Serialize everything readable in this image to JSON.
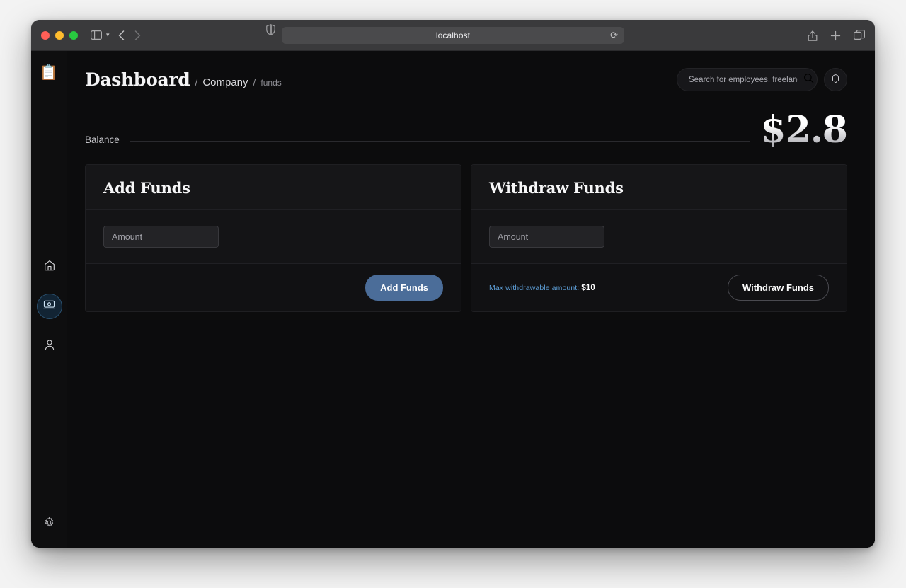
{
  "browser": {
    "url": "localhost",
    "icons": {
      "sidebar_toggle": "sidebar-toggle-icon",
      "tab_chevron": "chevron-down-icon",
      "back": "back-arrow-icon",
      "forward": "forward-arrow-icon",
      "shield": "privacy-shield-icon",
      "reload": "reload-icon",
      "share": "share-icon",
      "new_tab": "plus-icon",
      "tabs": "tab-overview-icon"
    }
  },
  "sidebar": {
    "logo": "📋",
    "items": [
      {
        "name": "home",
        "icon": "home-icon",
        "active": false
      },
      {
        "name": "funds",
        "icon": "money-card-icon",
        "active": true
      },
      {
        "name": "profile",
        "icon": "user-icon",
        "active": false
      }
    ],
    "settings": {
      "name": "settings",
      "icon": "gear-icon"
    }
  },
  "header": {
    "breadcrumb": {
      "title": "Dashboard",
      "separator1": "/",
      "company": "Company",
      "separator2": "/",
      "section": "funds"
    },
    "search": {
      "placeholder": "Search for employees, freelancers",
      "value": "",
      "icon": "search-icon"
    },
    "notifications_icon": "bell-icon"
  },
  "balance": {
    "label": "Balance",
    "value": "$2.8"
  },
  "cards": {
    "add_funds": {
      "title": "Add Funds",
      "input": {
        "placeholder": "Amount",
        "value": ""
      },
      "button": "Add Funds"
    },
    "withdraw_funds": {
      "title": "Withdraw Funds",
      "input": {
        "placeholder": "Amount",
        "value": ""
      },
      "note_label": "Max withdrawable amount:",
      "note_value": "$10",
      "button": "Withdraw Funds"
    }
  },
  "colors": {
    "accent_blue": "#4b6d99",
    "note_blue": "#5d9ed6",
    "app_bg": "#0c0c0d",
    "card_bg": "#0f0f11"
  }
}
